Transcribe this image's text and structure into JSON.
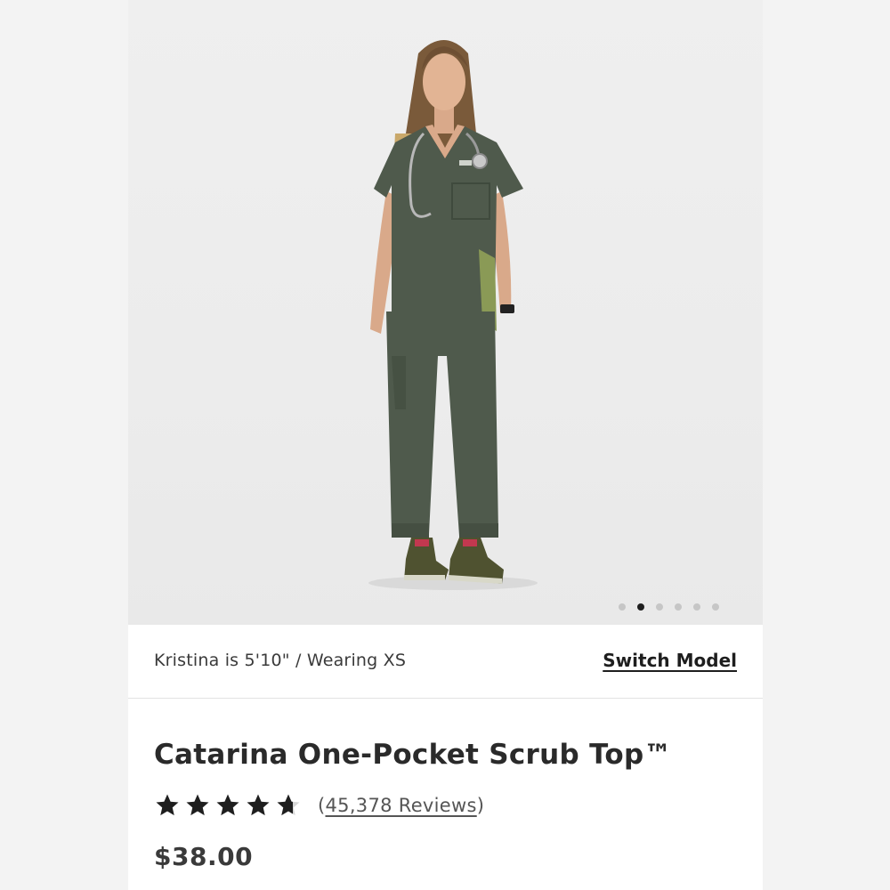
{
  "gallery": {
    "image_alt": "Model wearing olive scrubs with stethoscope and clipboard",
    "dots": [
      {
        "active": false
      },
      {
        "active": true
      },
      {
        "active": false
      },
      {
        "active": false
      },
      {
        "active": false
      },
      {
        "active": false
      }
    ]
  },
  "model_bar": {
    "info": "Kristina is 5'10\" / Wearing XS",
    "switch_label": "Switch Model"
  },
  "product": {
    "title": "Catarina One-Pocket Scrub Top™",
    "rating_value": 4.7,
    "rating_max": 5,
    "reviews_open": "(",
    "reviews_label": "45,378 Reviews",
    "reviews_close": ")",
    "price": "$38.00"
  },
  "colors": {
    "scrub_olive": "#4f5a4c",
    "text_dark": "#2a2a2a",
    "star": "#1e1e1e"
  },
  "icons": [
    "star-icon",
    "stethoscope-icon",
    "clipboard-icon"
  ]
}
